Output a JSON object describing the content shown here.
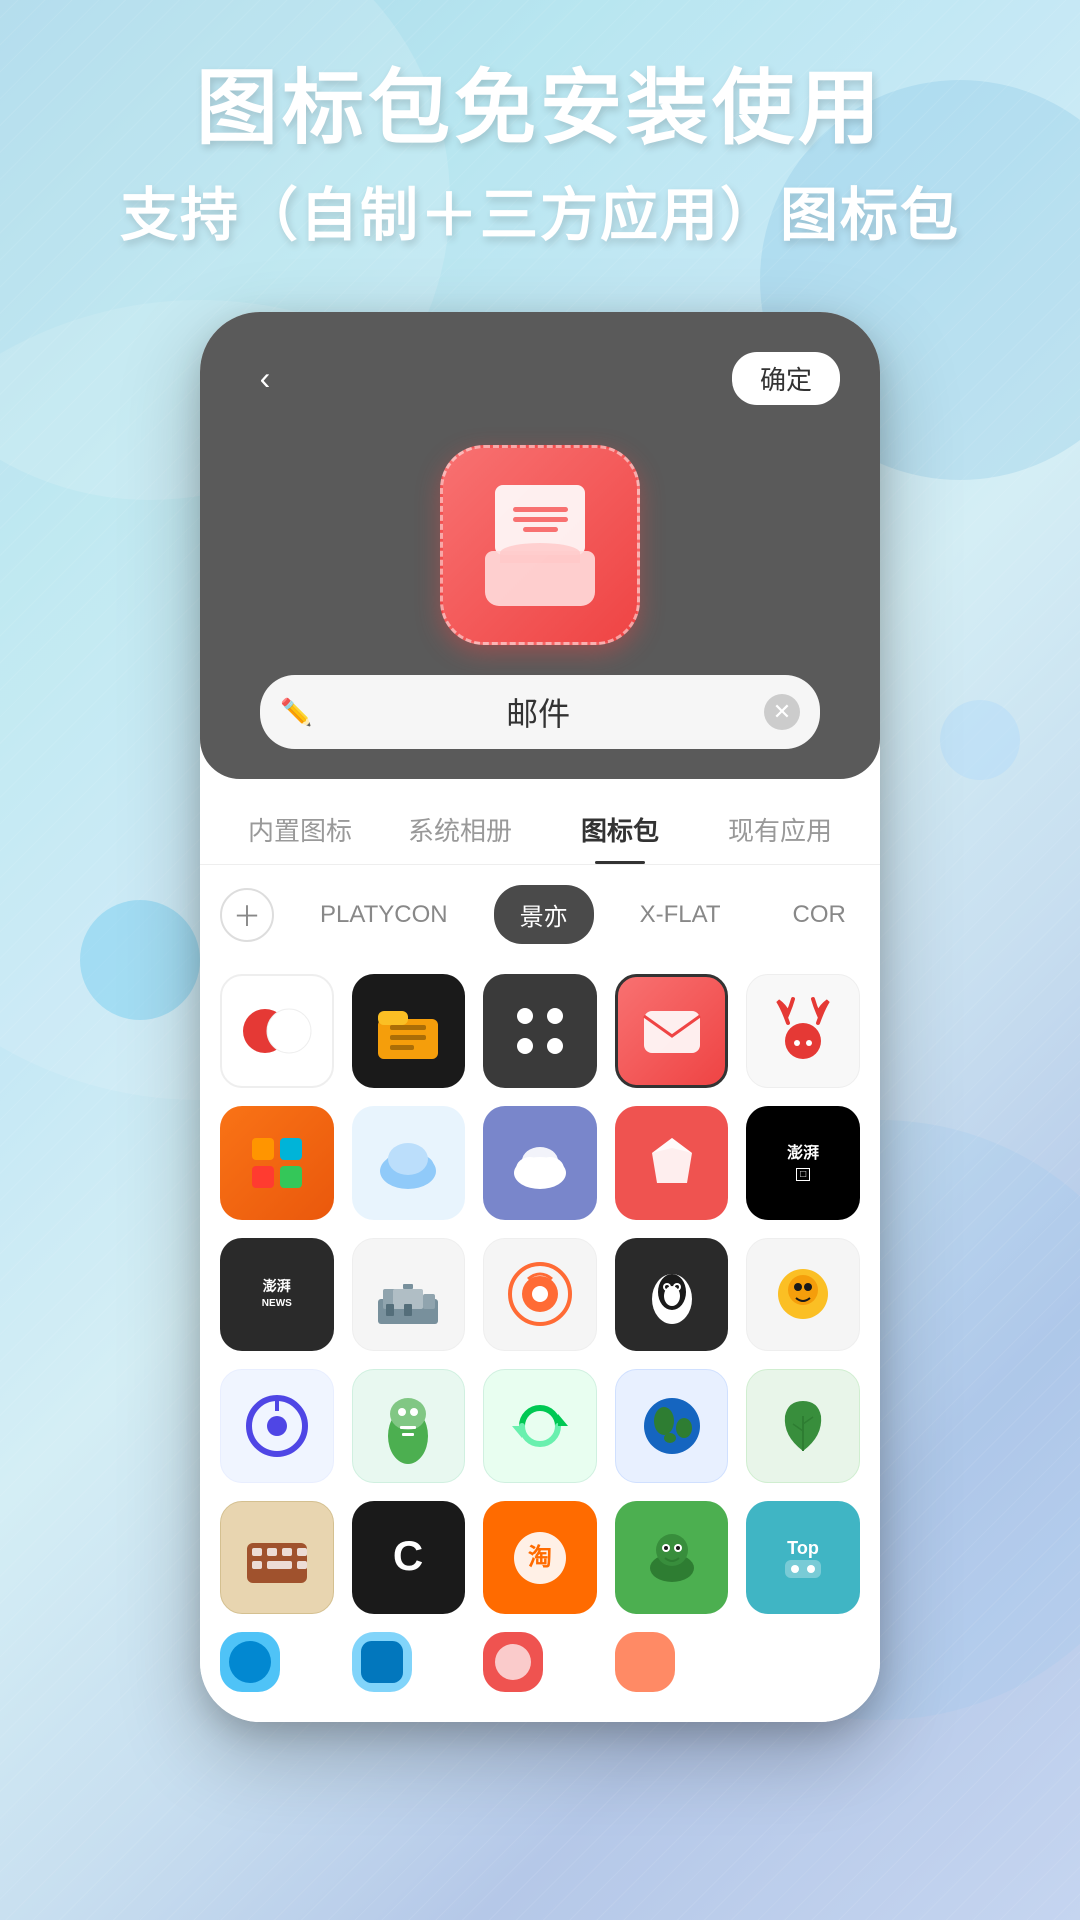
{
  "background": {
    "gradient_start": "#a8d8ea",
    "gradient_end": "#b5c8e8"
  },
  "header": {
    "main_title": "图标包免安装使用",
    "sub_title": "支持（自制＋三方应用）图标包"
  },
  "phone": {
    "back_button": "‹",
    "confirm_button": "确定",
    "app_name": "邮件",
    "tabs": [
      {
        "label": "内置图标",
        "active": false
      },
      {
        "label": "系统相册",
        "active": false
      },
      {
        "label": "图标包",
        "active": true
      },
      {
        "label": "现有应用",
        "active": false
      }
    ],
    "packs": [
      {
        "label": "+",
        "type": "add"
      },
      {
        "label": "PLATYCON",
        "active": false
      },
      {
        "label": "景亦",
        "active": true
      },
      {
        "label": "X-FLAT",
        "active": false
      },
      {
        "label": "COR",
        "active": false
      }
    ],
    "icons_grid": [
      {
        "emoji": "🔴⚪",
        "bg": "white",
        "type": "circles"
      },
      {
        "emoji": "📁",
        "bg": "#1a1a1a",
        "type": "folder-yellow"
      },
      {
        "emoji": "⬛",
        "bg": "#3a3a3a",
        "type": "dots"
      },
      {
        "emoji": "📧",
        "bg": "#ef4444",
        "type": "mail-selected"
      },
      {
        "emoji": "🦌",
        "bg": "#f5f5f5",
        "type": "deer"
      },
      {
        "emoji": "📊",
        "bg": "#f97316",
        "type": "office"
      },
      {
        "emoji": "☁",
        "bg": "#e8f4fd",
        "type": "cloud-blue"
      },
      {
        "emoji": "☁",
        "bg": "#7c9fdd",
        "type": "cloud-purple"
      },
      {
        "emoji": "💎",
        "bg": "#ef4444",
        "type": "gem"
      },
      {
        "emoji": "📰",
        "bg": "#000",
        "type": "news-澎湃"
      },
      {
        "emoji": "📰",
        "bg": "#2a2a2a",
        "type": "news-views"
      },
      {
        "emoji": "🏭",
        "bg": "#f5f5f5",
        "type": "factory"
      },
      {
        "emoji": "🌀",
        "bg": "#f5f5f5",
        "type": "spiral"
      },
      {
        "emoji": "🐧",
        "bg": "#2a2a2a",
        "type": "penguin"
      },
      {
        "emoji": "🟡",
        "bg": "#f5f5f5",
        "type": "yellow-blob"
      },
      {
        "emoji": "🔵",
        "bg": "#f0f5ff",
        "type": "blue-q"
      },
      {
        "emoji": "🦕",
        "bg": "#f0f8f0",
        "type": "dino"
      },
      {
        "emoji": "🔄",
        "bg": "#e8fef0",
        "type": "refresh"
      },
      {
        "emoji": "🌍",
        "bg": "#e8f0ff",
        "type": "earth"
      },
      {
        "emoji": "🌿",
        "bg": "#e8f5e9",
        "type": "leaf"
      },
      {
        "emoji": "⌨",
        "bg": "#e8d5b0",
        "type": "keyboard"
      },
      {
        "emoji": "C",
        "bg": "#1a1a1a",
        "type": "soloop"
      },
      {
        "emoji": "🛒",
        "bg": "#ff6b00",
        "type": "taobao"
      },
      {
        "emoji": "🐊",
        "bg": "#4caf50",
        "type": "croc"
      },
      {
        "emoji": "🎮",
        "bg": "#40b5c4",
        "type": "top-game"
      },
      {
        "emoji": "🔵",
        "bg": "#4fc3f7",
        "type": "partial-1"
      },
      {
        "emoji": "🔷",
        "bg": "#81d4fa",
        "type": "partial-2"
      },
      {
        "emoji": "🔴",
        "bg": "#ef5350",
        "type": "partial-3"
      },
      {
        "emoji": "🟠",
        "bg": "#ff8a65",
        "type": "partial-4"
      }
    ]
  }
}
